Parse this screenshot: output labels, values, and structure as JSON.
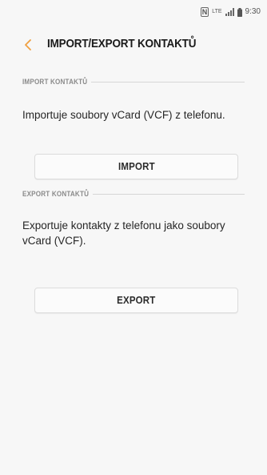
{
  "status_bar": {
    "nfc": "N",
    "network": "LTE",
    "time": "9:30"
  },
  "header": {
    "title": "IMPORT/EXPORT KONTAKTŮ",
    "back_icon": "chevron-left-icon",
    "accent_color": "#f0a040"
  },
  "import_section": {
    "header": "IMPORT KONTAKTŮ",
    "description": "Importuje soubory vCard (VCF) z telefonu.",
    "button_label": "IMPORT"
  },
  "export_section": {
    "header": "EXPORT KONTAKTŮ",
    "description": "Exportuje kontakty z telefonu jako soubory vCard (VCF).",
    "button_label": "EXPORT"
  }
}
